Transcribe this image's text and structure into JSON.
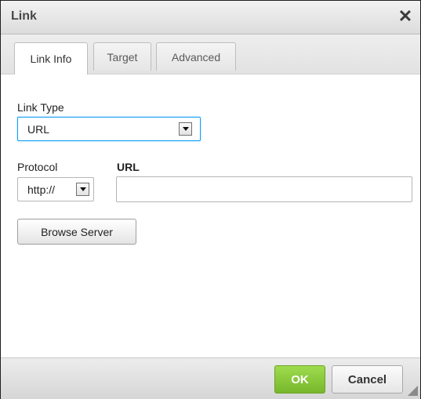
{
  "dialog": {
    "title": "Link",
    "close_glyph": "✕",
    "tabs": [
      {
        "label": "Link Info",
        "active": true
      },
      {
        "label": "Target",
        "active": false
      },
      {
        "label": "Advanced",
        "active": false
      }
    ]
  },
  "form": {
    "link_type_label": "Link Type",
    "link_type_value": "URL",
    "protocol_label": "Protocol",
    "protocol_value": "http://",
    "url_label": "URL",
    "url_value": "",
    "browse_label": "Browse Server"
  },
  "footer": {
    "ok_label": "OK",
    "cancel_label": "Cancel"
  },
  "colors": {
    "ok_green": "#8ccb3f",
    "focus_blue": "#139ff7"
  }
}
